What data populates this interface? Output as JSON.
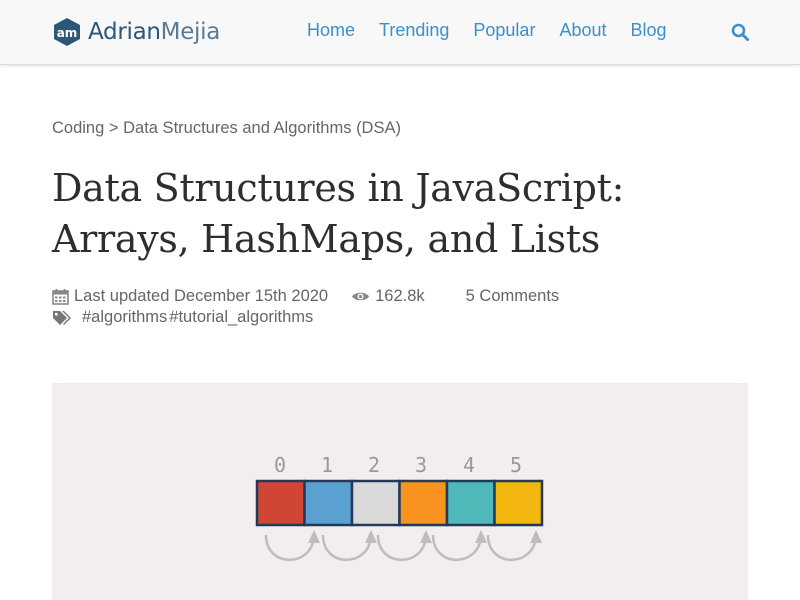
{
  "header": {
    "logo_first": "Adrian",
    "logo_last": "Mejia",
    "nav": [
      "Home",
      "Trending",
      "Popular",
      "About",
      "Blog"
    ]
  },
  "breadcrumb": {
    "category": "Coding",
    "separator": ">",
    "subcategory": "Data Structures and Algorithms (DSA)"
  },
  "post": {
    "title_line1": "Data Structures in JavaScript:",
    "title_line2": "Arrays, HashMaps, and Lists",
    "updated": "Last updated December 15th 2020",
    "views": "162.8k",
    "comments": "5 Comments",
    "tags": [
      "#algorithms",
      "#tutorial_algorithms"
    ]
  },
  "hero": {
    "indices": [
      "0",
      "1",
      "2",
      "3",
      "4",
      "5"
    ],
    "cell_colors": [
      "#d14534",
      "#5aa1d1",
      "#d9d9d9",
      "#f7931e",
      "#4fb9b9",
      "#f2b60f"
    ],
    "background": "#f2eeee",
    "cell_border": "#22395a"
  },
  "colors": {
    "link": "#3d8fc9",
    "text": "#666666",
    "title": "#2e2e2e"
  }
}
